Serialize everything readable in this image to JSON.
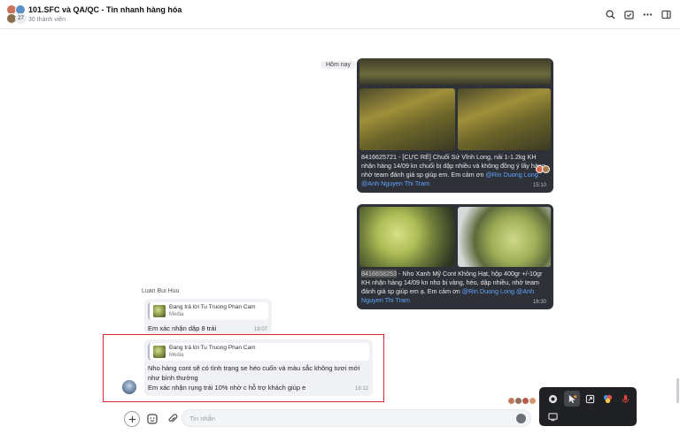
{
  "header": {
    "title": "101.SFC và QA/QC - Tin nhanh hàng hóa",
    "subtitle": "30 thành viên",
    "member_badge": "27"
  },
  "chat": {
    "day_separator": "Hôm nay",
    "card1": {
      "text_pre": "8416625721 - [CỰC RẺ] Chuối Sứ Vĩnh Long, nải 1-1.2kg KH nhận hàng 14/09 kn chuối bị dập nhiều và không đồng ý lấy hàng, nhờ team đánh giá sp giúp em. Em cảm ơn ",
      "mention1": "@Rin Duong Long",
      "space": " ",
      "mention2": "@Anh Nguyen Thi Tram",
      "time": "15:10"
    },
    "card2": {
      "code": "8416658253",
      "text_pre": " - Nho Xanh Mỹ Cont Không Hạt, hộp 400gr +/-10gr   KH nhận hàng 14/09 kn nho bị vàng, héo, dập nhiều, nhờ team đánh giá sp giúp em ạ. Em cảm ơn ",
      "mention1": "@Rin Duong Long",
      "space": " ",
      "mention2": "@Anh Nguyen Thi Tram",
      "time": "16:30"
    },
    "sender_name": "Luan Bui Huu",
    "message1": {
      "reply_title": "Đang trả lời Tu Truong Phan Cam",
      "reply_sub": "Media",
      "text": "Em xác nhận dập 8 trái",
      "time": "18:07"
    },
    "message2": {
      "reply_title": "Đang trả lời Tu Truong Phan Cam",
      "reply_sub": "Media",
      "line1": "Nho hàng cont sẽ có tình trạng se héo cuốn và màu sắc không tươi mới",
      "line2": "như bình thường",
      "line3": "Em xác nhận rụng trái 10% nhờ c hỗ trợ khách giúp e",
      "time": "18:12"
    }
  },
  "composer": {
    "placeholder": "Tin nhắn"
  },
  "colors": {
    "mention": "#5ea5ff",
    "highlight_border": "#e0282e",
    "card_bg": "#2f3138",
    "bubble_bg": "#f0f1f4"
  },
  "icons": {
    "header": [
      "search-icon",
      "calendar-check-icon",
      "more-icon",
      "sidebar-toggle-icon"
    ],
    "composer": [
      "add-icon",
      "sticker-icon",
      "attachment-icon",
      "emoji-icon"
    ],
    "floatbar": [
      "chrome-icon",
      "cursor-icon",
      "share-icon",
      "color-picker-icon",
      "microphone-icon",
      "screen-icon"
    ]
  }
}
